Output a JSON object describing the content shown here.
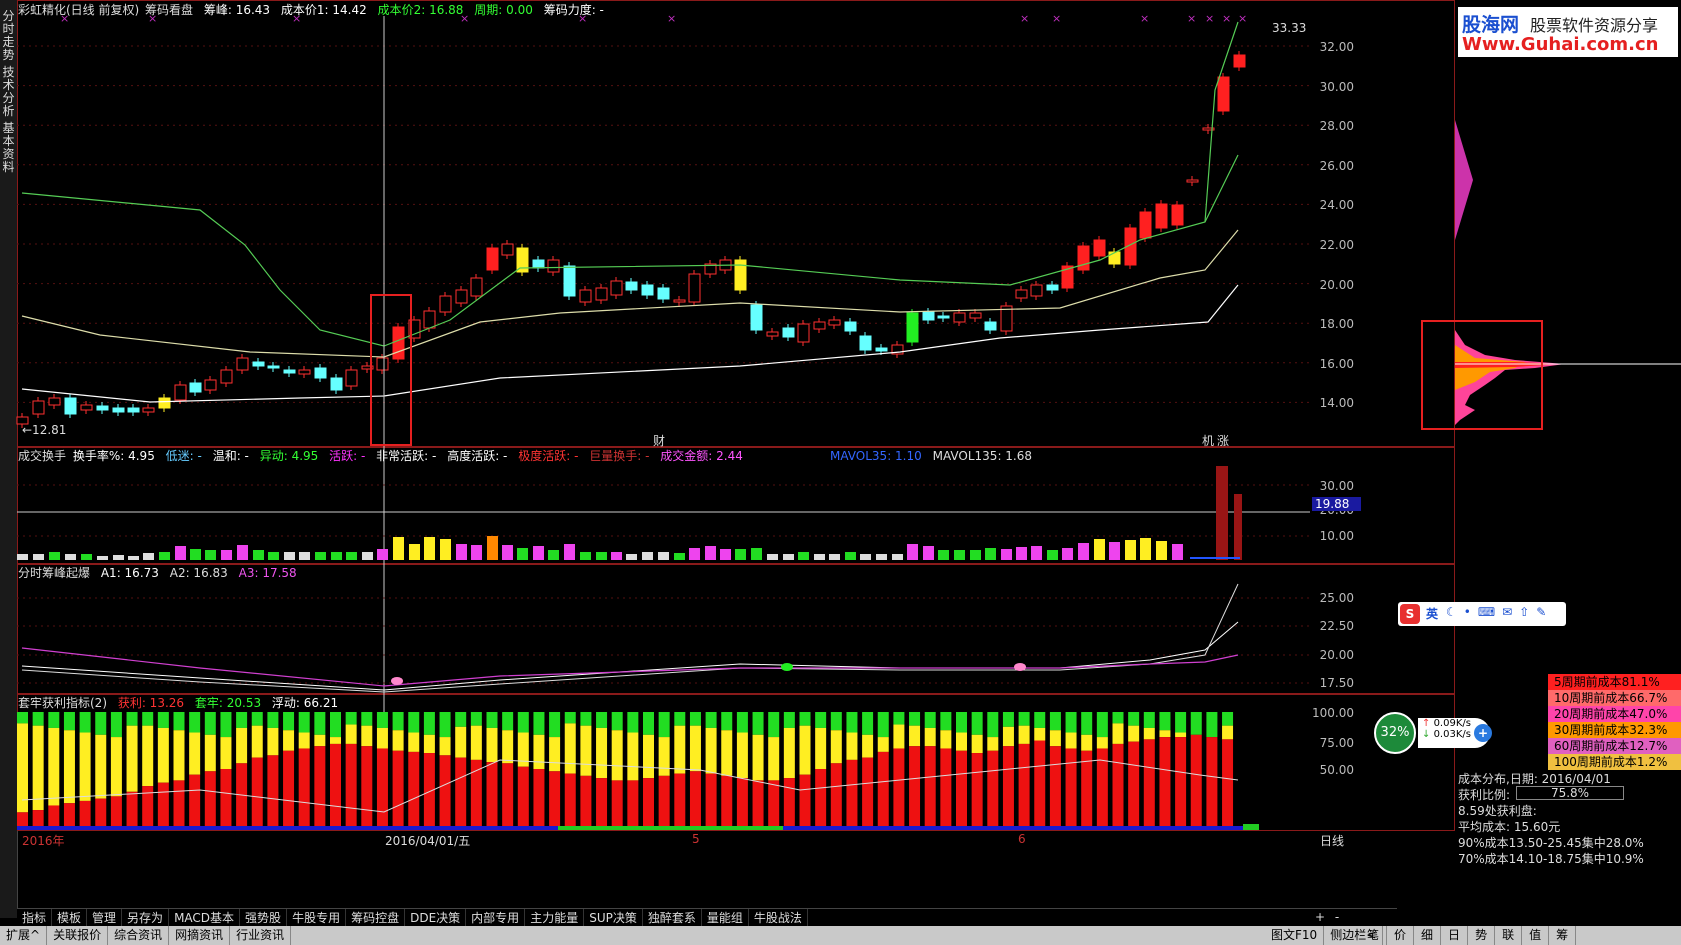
{
  "logo": {
    "brand": "股海网",
    "tagline": "股票软件资源分享",
    "url": "Www.Guhai.com.cn"
  },
  "left_tabs": [
    "分时走势",
    "技术分析",
    "基本资料"
  ],
  "main_header": {
    "title": "彩虹精化(日线 前复权)",
    "indicator": "筹码看盘",
    "peak": "筹峰: 16.43",
    "cost1": "成本价1: 14.42",
    "cost2": "成本价2: 16.88",
    "period": "周期: 0.00",
    "force": "筹码力度: -"
  },
  "price_axis": [
    "32.00",
    "30.00",
    "28.00",
    "26.00",
    "24.00",
    "22.00",
    "20.00",
    "18.00",
    "16.00",
    "14.00"
  ],
  "max_price_label": "33.33",
  "min_price_label": "←12.81",
  "markers": {
    "cai": "财",
    "ji": "机",
    "zhang": "涨"
  },
  "vol_header": {
    "name": "成交换手",
    "rate": "换手率%: 4.95",
    "low": "低迷: -",
    "mild": "温和: -",
    "abnormal": "异动: 4.95",
    "active": "活跃: -",
    "very_active": "非常活跃: -",
    "high_active": "高度活跃: -",
    "extreme": "极度活跃: -",
    "huge": "巨量换手: -",
    "amount": "成交金额: 2.44",
    "mavol35": "MAVOL35: 1.10",
    "mavol135": "MAVOL135: 1.68"
  },
  "vol_axis": [
    "30.00",
    "20.00",
    "10.00"
  ],
  "vol_tag": "19.88",
  "peak_header": {
    "name": "分时筹峰起爆",
    "a1": "A1: 16.73",
    "a2": "A2: 16.83",
    "a3": "A3: 17.58"
  },
  "peak_axis": [
    "25.00",
    "22.50",
    "20.00",
    "17.50"
  ],
  "trap_header": {
    "name": "套牢获利指标(2)",
    "profit": "获利: 13.26",
    "trapped": "套牢: 20.53",
    "float": "浮动: 66.21"
  },
  "trap_axis": [
    "100.00",
    "75.00",
    "50.00"
  ],
  "date_axis": {
    "year": "2016年",
    "cursor": "2016/04/01/五",
    "m5": "5",
    "m6": "6",
    "period": "日线"
  },
  "bottom_buttons": [
    "指标",
    "模板",
    "管理",
    "另存为",
    "MACD基本",
    "强势股",
    "牛股专用",
    "筹码控盘",
    "DDE决策",
    "内部专用",
    "主力能量",
    "SUP决策",
    "独醉套系",
    "量能组",
    "牛股战法"
  ],
  "zoom": [
    "+",
    "-",
    "0"
  ],
  "status_bar": {
    "left": [
      "扩展^",
      "关联报价",
      "综合资讯",
      "网摘资讯",
      "行业资讯"
    ],
    "mid": [
      "图文F10",
      "侧边栏<"
    ],
    "right": [
      "笔",
      "价",
      "细",
      "日",
      "势",
      "联",
      "值",
      "筹"
    ]
  },
  "ime": {
    "lang": "英"
  },
  "cost_legend": [
    {
      "label": "5周期前成本81.1%",
      "color": "#ff2020"
    },
    {
      "label": "10周期前成本66.7%",
      "color": "#ff6a6a"
    },
    {
      "label": "20周期前成本47.0%",
      "color": "#ff44aa"
    },
    {
      "label": "30周期前成本32.3%",
      "color": "#ff9900"
    },
    {
      "label": "60周期前成本12.7%",
      "color": "#e060c0"
    },
    {
      "label": "100周期前成本1.2%",
      "color": "#f0c040"
    }
  ],
  "network": {
    "pct": "32%",
    "up": "0.09K/s",
    "down": "0.03K/s"
  },
  "cost_info": {
    "date": "成本分布,日期: 2016/04/01",
    "ratio_label": "获利比例:",
    "ratio": "75.8%",
    "profit_price": "8.59处获利盘:",
    "avg": "平均成本: 15.60元",
    "c90": "90%成本13.50-25.45集中28.0%",
    "c70": "70%成本14.10-18.75集中10.9%"
  }
}
